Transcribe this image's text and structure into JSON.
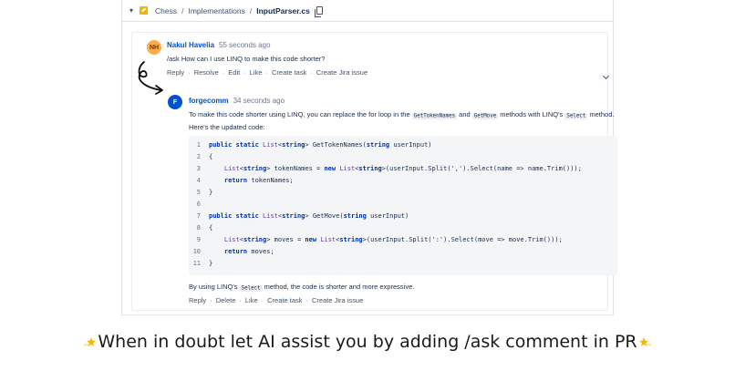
{
  "breadcrumb": {
    "items": [
      "Chess",
      "Implementations",
      "InputParser.cs"
    ],
    "separator": "/"
  },
  "comment1": {
    "avatar_initials": "NH",
    "author": "Nakul Havelia",
    "timestamp": "55 seconds ago",
    "body": "/ask How can I use LINQ to make this code shorter?",
    "actions": [
      "Reply",
      "Resolve",
      "Edit",
      "Like",
      "Create task",
      "Create Jira issue"
    ]
  },
  "reply": {
    "avatar_initials": "F",
    "author": "forgecomm",
    "timestamp": "34 seconds ago",
    "body_part1": "To make this code shorter using LINQ, you can replace the for loop in the ",
    "code1": "GetTokenNames",
    "body_part2": " and ",
    "code2": "GetMove",
    "body_part3": " methods with LINQ's ",
    "code3": "Select",
    "body_part4": " method.",
    "body_line2": "Here's the updated code:",
    "code_lines": [
      {
        "n": "1",
        "t": "public static List<string> GetTokenNames(string userInput)"
      },
      {
        "n": "2",
        "t": "{"
      },
      {
        "n": "3",
        "t": "    List<string> tokenNames = new List<string>(userInput.Split(',').Select(name => name.Trim()));"
      },
      {
        "n": "4",
        "t": "    return tokenNames;"
      },
      {
        "n": "5",
        "t": "}"
      },
      {
        "n": "6",
        "t": ""
      },
      {
        "n": "7",
        "t": "public static List<string> GetMove(string userInput)"
      },
      {
        "n": "8",
        "t": "{"
      },
      {
        "n": "9",
        "t": "    List<string> moves = new List<string>(userInput.Split(':').Select(move => move.Trim()));"
      },
      {
        "n": "10",
        "t": "    return moves;"
      },
      {
        "n": "11",
        "t": "}"
      }
    ],
    "footer_part1": "By using LINQ's ",
    "footer_code": "Select",
    "footer_part2": " method, the code is shorter and more expressive.",
    "actions": [
      "Reply",
      "Delete",
      "Like",
      "Create task",
      "Create Jira issue"
    ]
  },
  "caption": "When in doubt let AI assist you by adding /ask comment in PR",
  "colors": {
    "link": "#0052cc",
    "avatar_nh": "#ffab4a",
    "avatar_f": "#0052cc",
    "code_bg": "#f4f5f7"
  },
  "icons": [
    "chevron-down-icon",
    "file-icon",
    "copy-icon",
    "chevron-down-icon",
    "curved-arrow-icon",
    "sparkle-star-icon"
  ]
}
